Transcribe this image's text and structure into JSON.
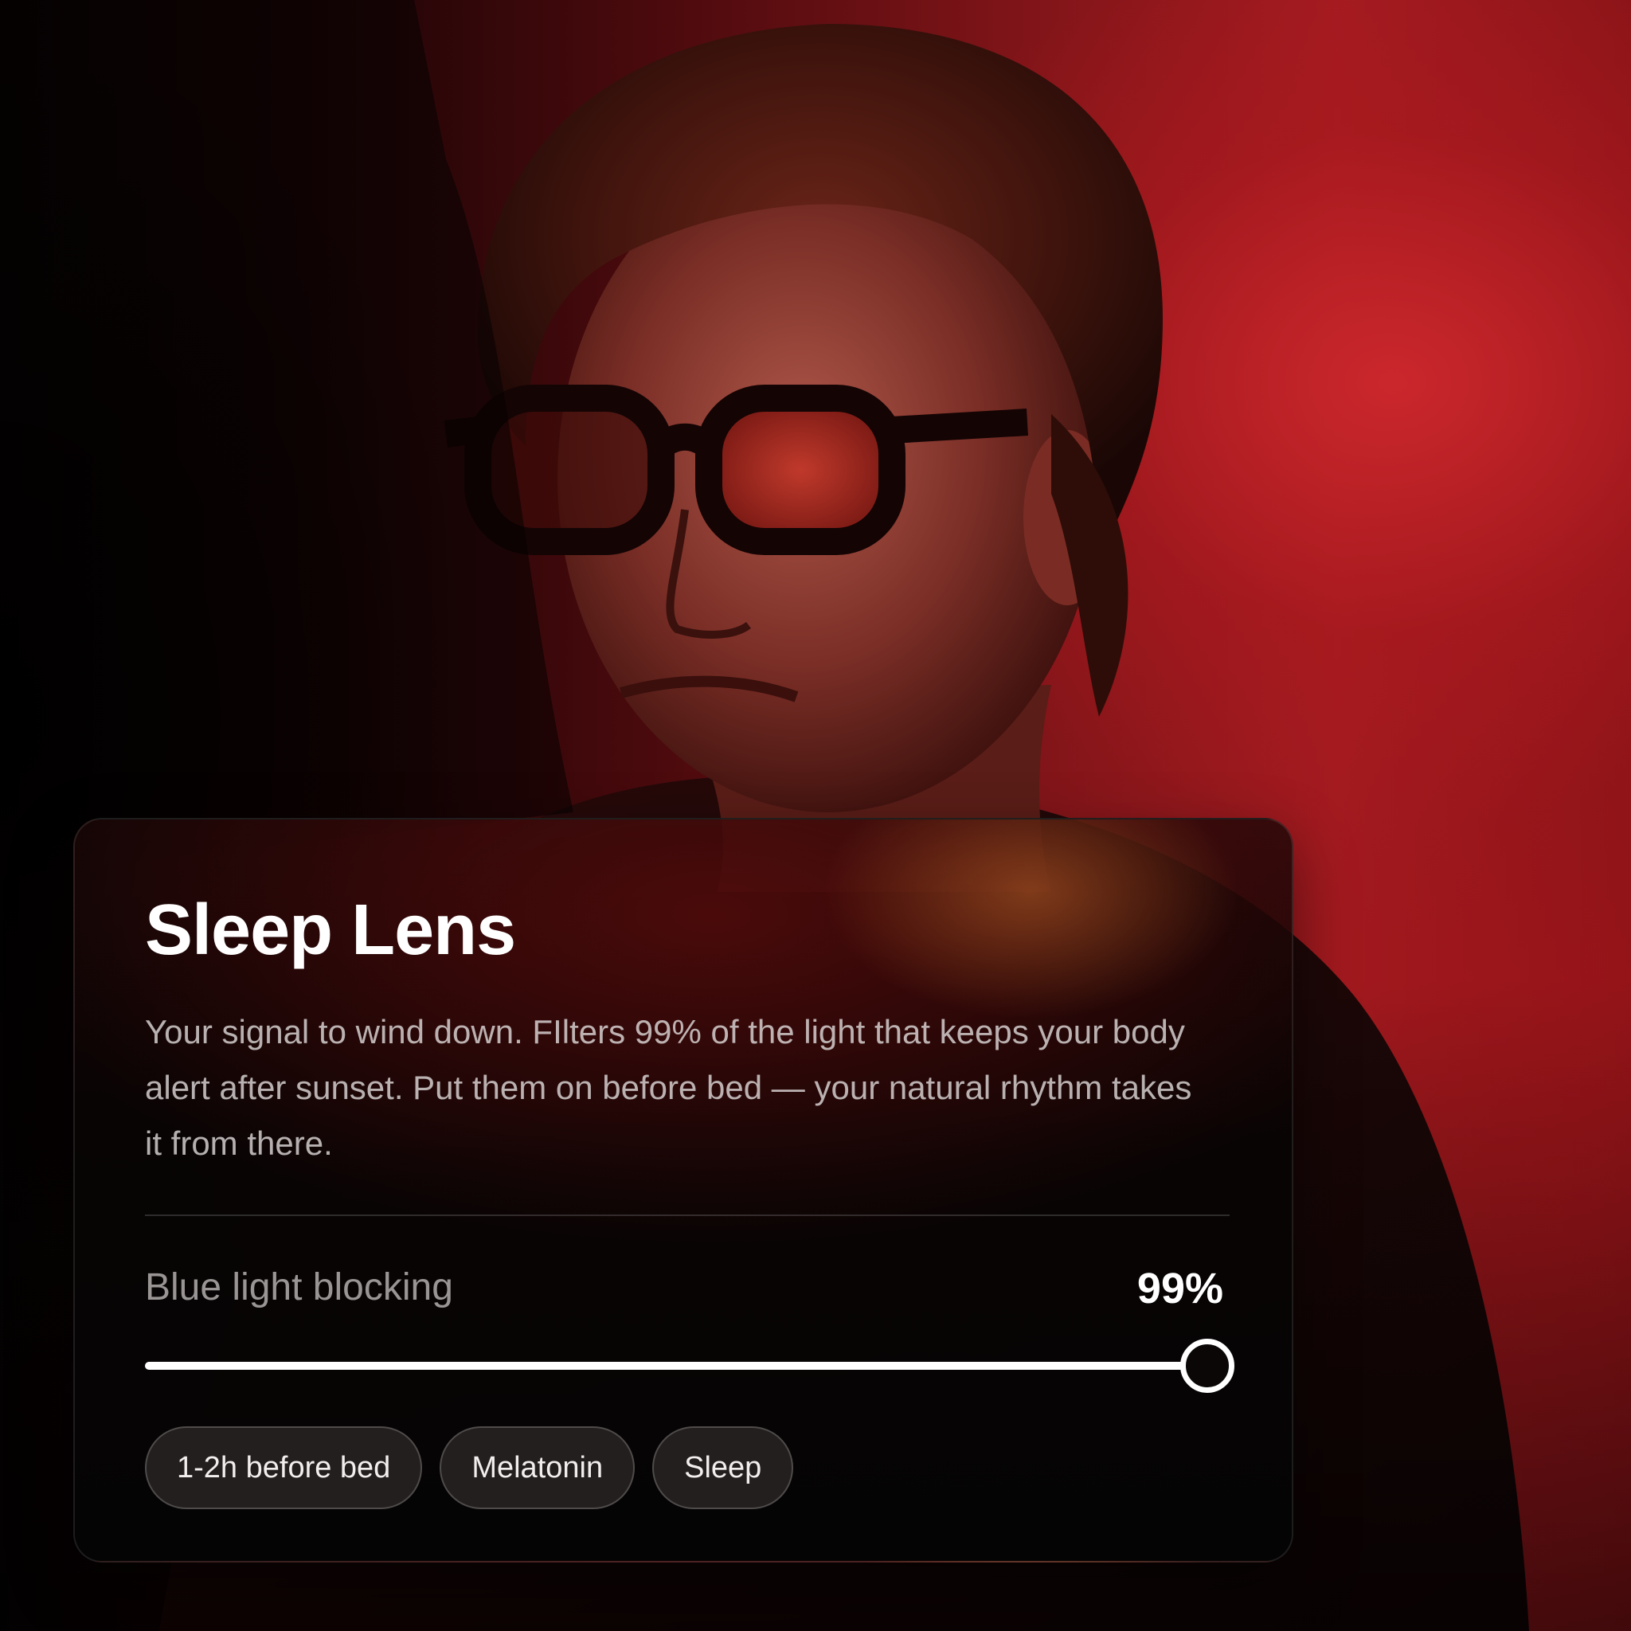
{
  "card": {
    "title": "Sleep Lens",
    "description": "Your signal to wind down. FIlters 99% of the light that keeps your body alert after sunset. Put them on before bed — your natural rhythm takes it from there.",
    "metric": {
      "label": "Blue light blocking",
      "value_text": "99%",
      "value": 0.99
    },
    "chips": [
      {
        "label": "1-2h before bed"
      },
      {
        "label": "Melatonin"
      },
      {
        "label": "Sleep"
      }
    ]
  },
  "colors": {
    "background_red": "#a31b20",
    "card_bg": "#0b0707",
    "accent_white": "#ffffff"
  }
}
